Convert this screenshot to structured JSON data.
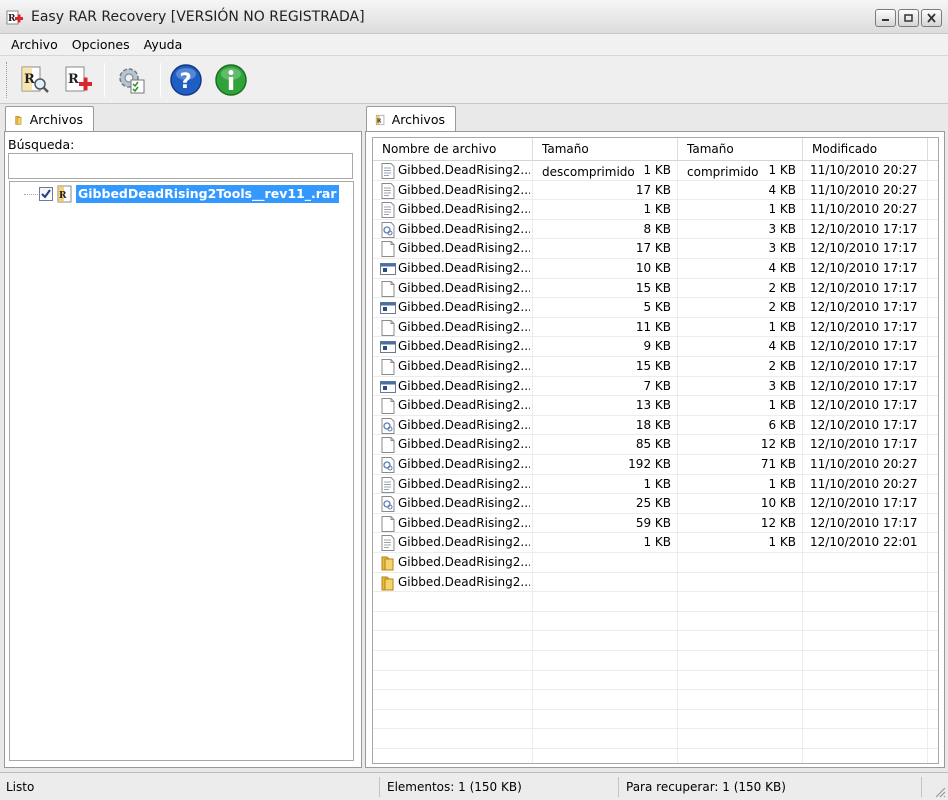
{
  "window": {
    "title": "Easy RAR Recovery [VERSIÓN NO REGISTRADA]"
  },
  "menu": [
    "Archivo",
    "Opciones",
    "Ayuda"
  ],
  "toolbar": {
    "buttons": [
      "rar-search-icon",
      "rar-repair-icon",
      "settings-icon",
      "help-icon",
      "info-icon"
    ]
  },
  "left_panel": {
    "tab_label": "Archivos",
    "search_label": "Búsqueda:",
    "search_value": "",
    "tree_item": "GibbedDeadRising2Tools__rev11_.rar",
    "tree_item_checked": true
  },
  "right_panel": {
    "tab_label": "Archivos",
    "columns": [
      "Nombre de archivo",
      "Tamaño descomprimido",
      "Tamaño comprimido",
      "Modificado"
    ],
    "rows": [
      {
        "icon": "text-file",
        "name": "Gibbed.DeadRising2....",
        "uncompressed": "1 KB",
        "compressed": "1 KB",
        "modified": "11/10/2010 20:27"
      },
      {
        "icon": "text-file",
        "name": "Gibbed.DeadRising2....",
        "uncompressed": "17 KB",
        "compressed": "4 KB",
        "modified": "11/10/2010 20:27"
      },
      {
        "icon": "text-file",
        "name": "Gibbed.DeadRising2....",
        "uncompressed": "1 KB",
        "compressed": "1 KB",
        "modified": "11/10/2010 20:27"
      },
      {
        "icon": "dll-file",
        "name": "Gibbed.DeadRising2....",
        "uncompressed": "8 KB",
        "compressed": "3 KB",
        "modified": "12/10/2010 17:17"
      },
      {
        "icon": "blank-file",
        "name": "Gibbed.DeadRising2....",
        "uncompressed": "17 KB",
        "compressed": "3 KB",
        "modified": "12/10/2010 17:17"
      },
      {
        "icon": "exe-file",
        "name": "Gibbed.DeadRising2....",
        "uncompressed": "10 KB",
        "compressed": "4 KB",
        "modified": "12/10/2010 17:17"
      },
      {
        "icon": "blank-file",
        "name": "Gibbed.DeadRising2....",
        "uncompressed": "15 KB",
        "compressed": "2 KB",
        "modified": "12/10/2010 17:17"
      },
      {
        "icon": "exe-file",
        "name": "Gibbed.DeadRising2....",
        "uncompressed": "5 KB",
        "compressed": "2 KB",
        "modified": "12/10/2010 17:17"
      },
      {
        "icon": "blank-file",
        "name": "Gibbed.DeadRising2....",
        "uncompressed": "11 KB",
        "compressed": "1 KB",
        "modified": "12/10/2010 17:17"
      },
      {
        "icon": "exe-file",
        "name": "Gibbed.DeadRising2....",
        "uncompressed": "9 KB",
        "compressed": "4 KB",
        "modified": "12/10/2010 17:17"
      },
      {
        "icon": "blank-file",
        "name": "Gibbed.DeadRising2....",
        "uncompressed": "15 KB",
        "compressed": "2 KB",
        "modified": "12/10/2010 17:17"
      },
      {
        "icon": "exe-file",
        "name": "Gibbed.DeadRising2....",
        "uncompressed": "7 KB",
        "compressed": "3 KB",
        "modified": "12/10/2010 17:17"
      },
      {
        "icon": "blank-file",
        "name": "Gibbed.DeadRising2....",
        "uncompressed": "13 KB",
        "compressed": "1 KB",
        "modified": "12/10/2010 17:17"
      },
      {
        "icon": "dll-file",
        "name": "Gibbed.DeadRising2....",
        "uncompressed": "18 KB",
        "compressed": "6 KB",
        "modified": "12/10/2010 17:17"
      },
      {
        "icon": "blank-file",
        "name": "Gibbed.DeadRising2....",
        "uncompressed": "85 KB",
        "compressed": "12 KB",
        "modified": "12/10/2010 17:17"
      },
      {
        "icon": "dll-file",
        "name": "Gibbed.DeadRising2....",
        "uncompressed": "192 KB",
        "compressed": "71 KB",
        "modified": "11/10/2010 20:27"
      },
      {
        "icon": "text-file",
        "name": "Gibbed.DeadRising2....",
        "uncompressed": "1 KB",
        "compressed": "1 KB",
        "modified": "11/10/2010 20:27"
      },
      {
        "icon": "dll-file",
        "name": "Gibbed.DeadRising2....",
        "uncompressed": "25 KB",
        "compressed": "10 KB",
        "modified": "12/10/2010 17:17"
      },
      {
        "icon": "blank-file",
        "name": "Gibbed.DeadRising2....",
        "uncompressed": "59 KB",
        "compressed": "12 KB",
        "modified": "12/10/2010 17:17"
      },
      {
        "icon": "text-file",
        "name": "Gibbed.DeadRising2....",
        "uncompressed": "1 KB",
        "compressed": "1 KB",
        "modified": "12/10/2010 22:01"
      },
      {
        "icon": "folder",
        "name": "Gibbed.DeadRising2....",
        "uncompressed": "",
        "compressed": "",
        "modified": ""
      },
      {
        "icon": "folder",
        "name": "Gibbed.DeadRising2....",
        "uncompressed": "",
        "compressed": "",
        "modified": ""
      }
    ]
  },
  "status": {
    "state": "Listo",
    "elements": "Elementos: 1 (150 KB)",
    "to_recover": "Para recuperar: 1 (150 KB)"
  },
  "colors": {
    "selection": "#3399ff",
    "rar_red": "#d8262c",
    "help_blue": "#1f5fc4",
    "info_green": "#2fa33a"
  }
}
